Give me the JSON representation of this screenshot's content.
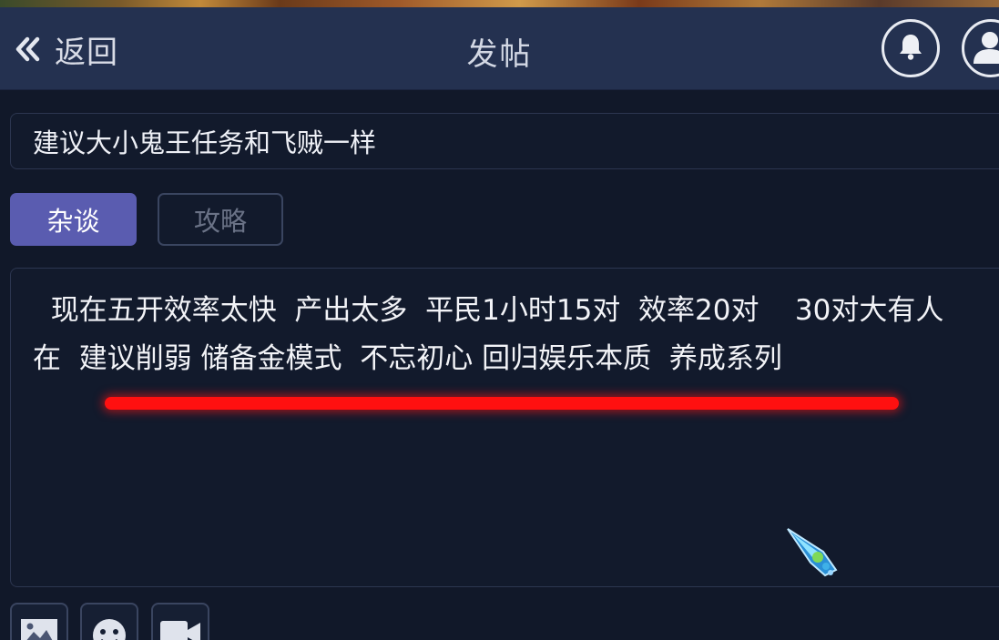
{
  "header": {
    "back_label": "返回",
    "title": "发帖",
    "back_icon": "double-chevron-left-icon",
    "notification_icon": "bell-icon",
    "user_icon": "user-avatar-icon"
  },
  "post": {
    "title_value": "建议大小鬼王任务和飞贼一样",
    "tags": [
      {
        "label": "杂谈",
        "selected": true
      },
      {
        "label": "攻略",
        "selected": false
      }
    ],
    "body_text": "  现在五开效率太快  产出太多  平民1小时15对  效率20对    30对大有人在  建议削弱 储备金模式  不忘初心 回归娱乐本质  养成系列"
  },
  "toolbar": {
    "icons": [
      "image-icon",
      "emoji-icon",
      "video-icon"
    ]
  },
  "colors": {
    "header_bg": "#243150",
    "page_bg": "#111829",
    "selected_tag": "#5a5cb0",
    "annotation_underline": "#ff1010"
  }
}
